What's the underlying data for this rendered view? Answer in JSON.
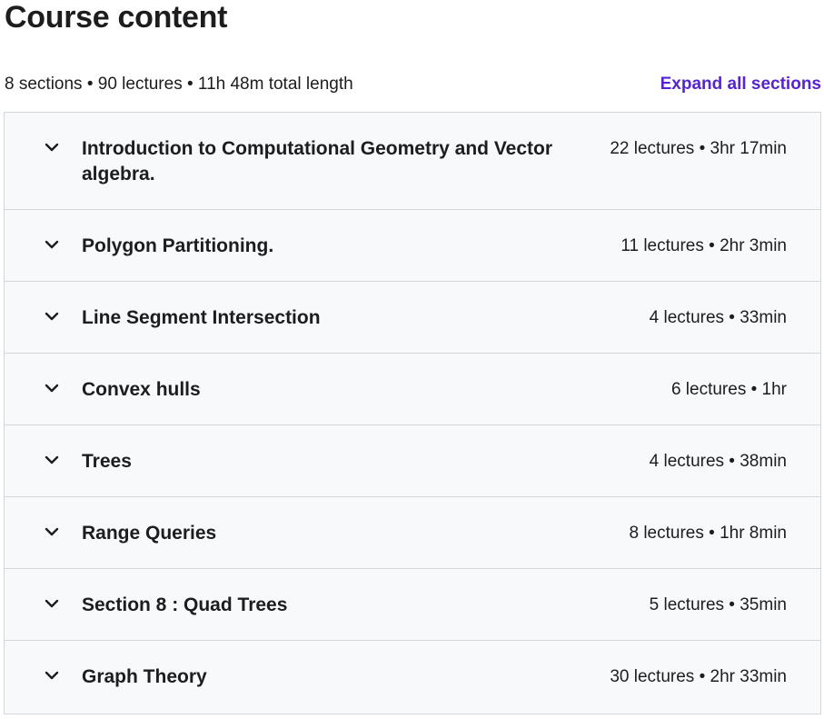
{
  "header": {
    "title": "Course content"
  },
  "summary": {
    "text": "8 sections • 90 lectures • 11h 48m total length",
    "expand_label": "Expand all sections"
  },
  "sections": [
    {
      "title": "Introduction to Computational Geometry and Vector algebra.",
      "meta": "22 lectures • 3hr 17min"
    },
    {
      "title": "Polygon Partitioning.",
      "meta": "11 lectures • 2hr 3min"
    },
    {
      "title": "Line Segment Intersection",
      "meta": "4 lectures • 33min"
    },
    {
      "title": "Convex hulls",
      "meta": "6 lectures • 1hr"
    },
    {
      "title": "Trees",
      "meta": "4 lectures • 38min"
    },
    {
      "title": "Range Queries",
      "meta": "8 lectures • 1hr 8min"
    },
    {
      "title": "Section 8 : Quad Trees",
      "meta": "5 lectures • 35min"
    },
    {
      "title": "Graph Theory",
      "meta": "30 lectures • 2hr 33min"
    }
  ],
  "icons": {
    "section_toggle": "chevron-down-icon"
  },
  "colors": {
    "accent": "#5624d0",
    "text": "#1c1d1f",
    "panel_bg": "#f7f9fa",
    "border": "#d1d7dc"
  }
}
